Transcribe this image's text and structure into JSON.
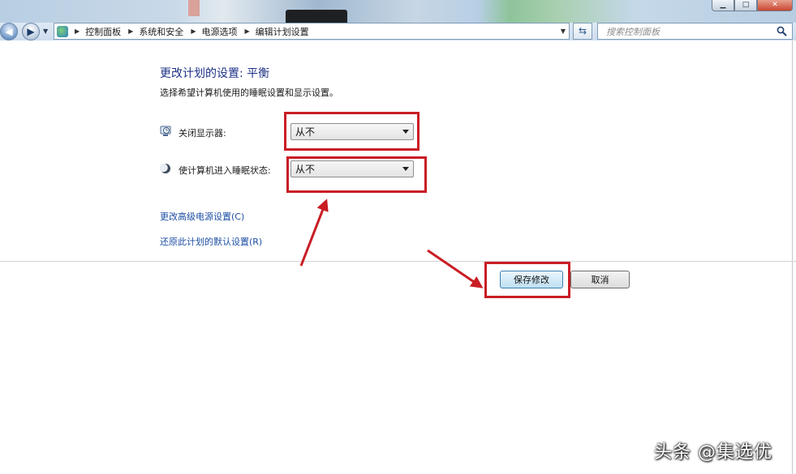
{
  "window": {
    "caption_buttons": [
      "minimize",
      "maximize",
      "close"
    ]
  },
  "address_bar": {
    "breadcrumbs": [
      "控制面板",
      "系统和安全",
      "电源选项",
      "编辑计划设置"
    ],
    "search_placeholder": "搜索控制面板"
  },
  "main": {
    "title": "更改计划的设置: 平衡",
    "subtitle": "选择希望计算机使用的睡眠设置和显示设置。",
    "settings": [
      {
        "label": "关闭显示器:",
        "icon": "monitor-icon",
        "value": "从不"
      },
      {
        "label": "使计算机进入睡眠状态:",
        "icon": "moon-icon",
        "value": "从不"
      }
    ],
    "links": [
      "更改高级电源设置(C)",
      "还原此计划的默认设置(R)"
    ],
    "buttons": {
      "save": "保存修改",
      "cancel": "取消"
    }
  },
  "annotation": {
    "highlight_color": "#c91d24"
  },
  "watermark": "头条 @集选优"
}
